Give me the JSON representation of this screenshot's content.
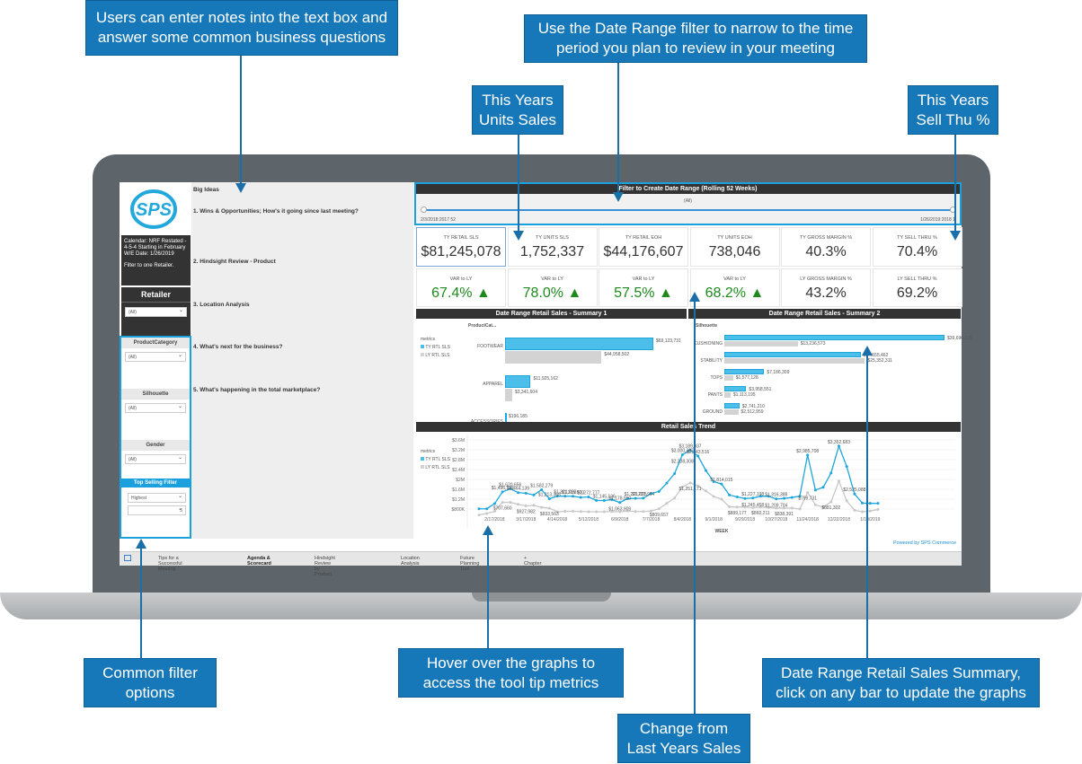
{
  "callouts": {
    "notes": "Users can enter notes into the text box and answer some common business questions",
    "date_range": "Use the Date Range filter to narrow to the time period you plan to review in your meeting",
    "units": "This Years Units Sales",
    "sell_thru": "This Years Sell Thu %",
    "filters": "Common filter options",
    "hover": "Hover over the graphs to access the tool tip metrics",
    "change": "Change from Last Years Sales",
    "summary": "Date Range Retail Sales Summary, click on any bar to update the graphs"
  },
  "colors": {
    "callout": "#1778b9",
    "ty": "#4bbfea",
    "ly": "#d3d3d3",
    "positive": "#1e8a1e",
    "header": "#333333"
  },
  "sidebar": {
    "logo": "SPS",
    "calendar": "Calendar: NRF Restated - 4-5-4 Starting in February",
    "we_date": "W/E Date: 1/26/2019",
    "filter_note": "Filter to one Retailer.",
    "retailer_title": "Retailer",
    "retailer_value": "(All)",
    "filters": [
      {
        "title": "ProductCategory",
        "value": "(All)"
      },
      {
        "title": "Silhouette",
        "value": "(All)"
      },
      {
        "title": "Gender",
        "value": "(All)"
      }
    ],
    "top_selling": {
      "title": "Top Selling Filter",
      "value": "Highest",
      "count": "5"
    }
  },
  "notes": {
    "title": "Big Ideas",
    "items": [
      "1. Wins & Opportunities; How's it going since last meeting?",
      "2. Hindsight Review - Product",
      "3. Location Analysis",
      "4. What's next for the business?",
      "5. What's happening in the total marketplace?"
    ]
  },
  "date_filter": {
    "title": "Filter to Create Date Range (Rolling 52 Weeks)",
    "value": "(All)",
    "start": "2/3/2018:2017 52",
    "end": "1/26/2019:2018 1"
  },
  "kpis_top": [
    {
      "label": "TY RETAIL SLS",
      "value": "$81,245,078"
    },
    {
      "label": "TY UNITS SLS",
      "value": "1,752,337"
    },
    {
      "label": "TY RETAIL EOH",
      "value": "$44,176,607"
    },
    {
      "label": "TY UNITS EOH",
      "value": "738,046"
    },
    {
      "label": "TY GROSS MARGIN %",
      "value": "40.3%"
    },
    {
      "label": "TY SELL THRU %",
      "value": "70.4%"
    }
  ],
  "kpis_bottom": [
    {
      "label": "VAR to LY",
      "value": "67.4%",
      "up": true
    },
    {
      "label": "VAR to LY",
      "value": "78.0%",
      "up": true
    },
    {
      "label": "VAR to LY",
      "value": "57.5%",
      "up": true
    },
    {
      "label": "VAR to LY",
      "value": "68.2%",
      "up": true
    },
    {
      "label": "LY GROSS MARGIN %",
      "value": "43.2%"
    },
    {
      "label": "LY SELL THRU %",
      "value": "69.2%"
    }
  ],
  "legend": {
    "title": "metrics",
    "ty": "TY RTL SLS",
    "ly": "LY RTL SLS"
  },
  "summary1": {
    "title": "Date Range Retail Sales - Summary 1",
    "dim": "ProductCat...",
    "rows": [
      {
        "cat": "FOOTWEAR",
        "ty": 69123731,
        "ly": 44958502,
        "ty_label": "$69,123,731",
        "ly_label": "$44,958,502"
      },
      {
        "cat": "APPAREL",
        "ty": 11925162,
        "ly": 3341604,
        "ty_label": "$11,925,162",
        "ly_label": "$3,341,604"
      },
      {
        "cat": "ACCESSORIES",
        "ty": 196185,
        "ly": 76560,
        "ty_label": "$196,185",
        "ly_label": "$76,560"
      }
    ]
  },
  "summary2": {
    "title": "Date Range Retail Sales - Summary 2",
    "dim": "Silhouette",
    "rows": [
      {
        "cat": "CUSHIONING",
        "ty": 39696115,
        "ly": 13236573,
        "ty_label": "$39,696,115",
        "ly_label": "$13,236,573"
      },
      {
        "cat": "STABILITY",
        "ty": 24555462,
        "ly": 25352311,
        "ty_label": "$24,555,462",
        "ly_label": "$25,352,311"
      },
      {
        "cat": "TOPS",
        "ty": 7186309,
        "ly": 1577128,
        "ty_label": "$7,186,309",
        "ly_label": "$1,577,128"
      },
      {
        "cat": "PANTS",
        "ty": 3958551,
        "ly": 1113195,
        "ty_label": "$3,958,551",
        "ly_label": "$1,113,195"
      },
      {
        "cat": "GROUND",
        "ty": 2741210,
        "ly": 2512959,
        "ty_label": "$2,741,210",
        "ly_label": "$2,512,959"
      }
    ]
  },
  "chart_data": {
    "type": "line",
    "title": "Retail Sales Trend",
    "xlabel": "WEEK",
    "ylabel": "",
    "ylim": [
      800000,
      3600000
    ],
    "yticks": [
      "$800K",
      "$1.2M",
      "$1.6M",
      "$2M",
      "$2.4M",
      "$2.8M",
      "$3.2M",
      "$3.6M"
    ],
    "xticks": [
      {
        "i": 2,
        "label": "2/17/2018"
      },
      {
        "i": 6,
        "label": "3/17/2018"
      },
      {
        "i": 10,
        "label": "4/14/2018"
      },
      {
        "i": 14,
        "label": "5/12/2018"
      },
      {
        "i": 18,
        "label": "6/9/2018"
      },
      {
        "i": 22,
        "label": "7/7/2018"
      },
      {
        "i": 26,
        "label": "8/4/2018"
      },
      {
        "i": 30,
        "label": "9/1/2018"
      },
      {
        "i": 34,
        "label": "9/29/2018"
      },
      {
        "i": 38,
        "label": "10/27/2018"
      },
      {
        "i": 42,
        "label": "11/24/2018"
      },
      {
        "i": 46,
        "label": "12/22/2018"
      },
      {
        "i": 50,
        "label": "1/19/2019"
      }
    ],
    "series": [
      {
        "name": "TY RTL SLS",
        "values": [
          810,
          810,
          1020,
          1496,
          1621,
          1464,
          1440,
          1370,
          1582,
          1213,
          1321,
          1321,
          1316,
          1273,
          1290,
          1145,
          1145,
          1179,
          1064,
          1221,
          1232,
          1240,
          1430,
          1510,
          1850,
          2238,
          3000,
          3190,
          2944,
          2360,
          1910,
          1814,
          1370,
          1290,
          1227,
          1245,
          1320,
          1316,
          1210,
          1230,
          1270,
          1320,
          2986,
          1570,
          1680,
          2260,
          3353,
          2525,
          1410,
          1040,
          1030,
          1030
        ]
      },
      {
        "name": "LY RTL SLS",
        "values": [
          560,
          620,
          708,
          1070,
          1070,
          990,
          928,
          950,
          870,
          834,
          690,
          710,
          710,
          700,
          690,
          690,
          690,
          700,
          690,
          720,
          700,
          700,
          720,
          809,
          1030,
          1251,
          1690,
          1860,
          1740,
          1530,
          1310,
          1200,
          889,
          880,
          880,
          860,
          880,
          860,
          838,
          840,
          840,
          800,
          1470,
          970,
          881,
          1090,
          1930,
          1130,
          750,
          690,
          720,
          780
        ]
      }
    ],
    "labels": [
      {
        "s": 0,
        "i": 3,
        "text": "$1,496,119"
      },
      {
        "s": 0,
        "i": 4,
        "text": "$1,620,656"
      },
      {
        "s": 0,
        "i": 5,
        "text": "$1,464,139"
      },
      {
        "s": 0,
        "i": 8,
        "text": "$1,582,279"
      },
      {
        "s": 0,
        "i": 9,
        "text": "$1,213,368"
      },
      {
        "s": 0,
        "i": 11,
        "text": "$1,321,033"
      },
      {
        "s": 0,
        "i": 12,
        "text": "$1,315,600"
      },
      {
        "s": 0,
        "i": 14,
        "text": "$1,272,777"
      },
      {
        "s": 0,
        "i": 16,
        "text": "$1,145,136"
      },
      {
        "s": 0,
        "i": 18,
        "text": "$1,178,910"
      },
      {
        "s": 0,
        "i": 18,
        "text": "$1,063,909"
      },
      {
        "s": 0,
        "i": 20,
        "text": "$1,221,025"
      },
      {
        "s": 0,
        "i": 21,
        "text": "$1,231,964"
      },
      {
        "s": 0,
        "i": 26,
        "text": "$3,000,307"
      },
      {
        "s": 0,
        "i": 27,
        "text": "$3,189,937"
      },
      {
        "s": 0,
        "i": 28,
        "text": "$2,943,516"
      },
      {
        "s": 0,
        "i": 26,
        "text": "$2,238,308"
      },
      {
        "s": 0,
        "i": 31,
        "text": "$1,814,015"
      },
      {
        "s": 0,
        "i": 35,
        "text": "$1,227,198"
      },
      {
        "s": 0,
        "i": 35,
        "text": "$1,245,458"
      },
      {
        "s": 0,
        "i": 38,
        "text": "$1,316,388"
      },
      {
        "s": 0,
        "i": 38,
        "text": "$1,209,704"
      },
      {
        "s": 0,
        "i": 42,
        "text": "$2,985,708"
      },
      {
        "s": 0,
        "i": 46,
        "text": "$3,352,683"
      },
      {
        "s": 0,
        "i": 48,
        "text": "$2,525,088"
      },
      {
        "s": 1,
        "i": 3,
        "text": "$707,660"
      },
      {
        "s": 1,
        "i": 6,
        "text": "$927,982"
      },
      {
        "s": 1,
        "i": 9,
        "text": "$833,563"
      },
      {
        "s": 1,
        "i": 23,
        "text": "$809,657"
      },
      {
        "s": 1,
        "i": 27,
        "text": "$1,251,171"
      },
      {
        "s": 1,
        "i": 33,
        "text": "$889,177"
      },
      {
        "s": 1,
        "i": 36,
        "text": "$860,211"
      },
      {
        "s": 1,
        "i": 39,
        "text": "$838,391"
      },
      {
        "s": 1,
        "i": 42,
        "text": "$799,731"
      },
      {
        "s": 1,
        "i": 45,
        "text": "$881,302"
      }
    ]
  },
  "footer": {
    "powered": "Powered by SPS Commerce"
  },
  "tabs": [
    "Tips for a Successful Meeting",
    "Agenda & Scorecard",
    "Hindsight Review by Product",
    "Location Analysis",
    "Future Planning Tool",
    "+ Chapter"
  ]
}
